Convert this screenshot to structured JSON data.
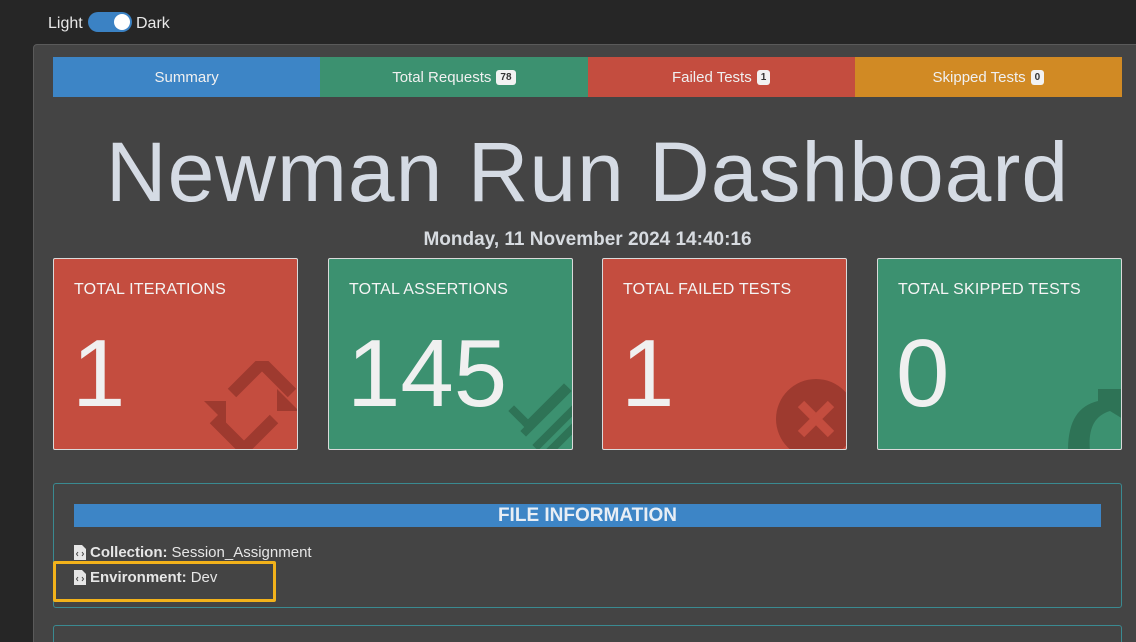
{
  "theme": {
    "light_label": "Light",
    "dark_label": "Dark",
    "toggle_state": "dark"
  },
  "nav": {
    "tabs": [
      {
        "label": "Summary",
        "badge": null
      },
      {
        "label": "Total Requests",
        "badge": "78"
      },
      {
        "label": "Failed Tests",
        "badge": "1"
      },
      {
        "label": "Skipped Tests",
        "badge": "0"
      }
    ]
  },
  "header": {
    "title": "Newman Run Dashboard",
    "date": "Monday, 11 November 2024 14:40:16"
  },
  "cards": [
    {
      "label": "TOTAL ITERATIONS",
      "value": "1",
      "color": "#c44d3f",
      "icon": "refresh-icon"
    },
    {
      "label": "TOTAL ASSERTIONS",
      "value": "145",
      "color": "#3c9170",
      "icon": "tasks-icon"
    },
    {
      "label": "TOTAL FAILED TESTS",
      "value": "1",
      "color": "#c44d3f",
      "icon": "times-circle-icon"
    },
    {
      "label": "TOTAL SKIPPED TESTS",
      "value": "0",
      "color": "#3c9170",
      "icon": "share-arrow-icon"
    }
  ],
  "file_info": {
    "heading": "FILE INFORMATION",
    "collection_label": "Collection:",
    "collection_value": "Session_Assignment",
    "environment_label": "Environment:",
    "environment_value": "Dev"
  },
  "colors": {
    "summary": "#3d85c6",
    "success": "#3c9170",
    "danger": "#c44d3f",
    "warning": "#d18a24",
    "highlight": "#f2b21b"
  }
}
